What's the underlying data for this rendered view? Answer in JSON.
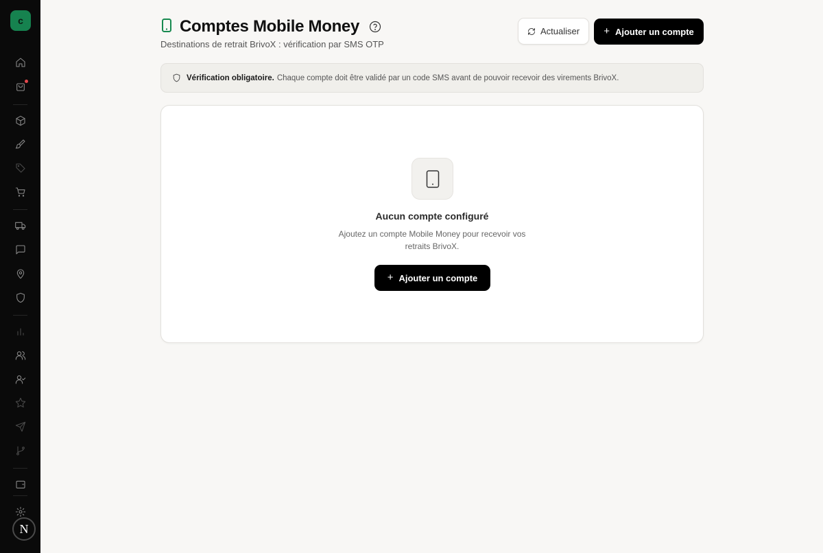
{
  "sidebar": {
    "logo_letter": "c",
    "avatar_letter": "N",
    "icons": [
      "home-icon",
      "shopping-bag-icon",
      "package-icon",
      "brush-icon",
      "tag-icon",
      "cart-icon",
      "truck-icon",
      "message-icon",
      "map-pin-icon",
      "shield-icon",
      "bar-chart-icon",
      "users-icon",
      "user-check-icon",
      "star-icon",
      "send-icon",
      "git-branch-icon",
      "wallet-icon",
      "settings-icon"
    ],
    "notification_color": "#e5484d"
  },
  "header": {
    "title": "Comptes Mobile Money",
    "subtitle": "Destinations de retrait BrivoX : vérification par SMS OTP",
    "refresh_label": "Actualiser",
    "add_label": "Ajouter un compte",
    "accent_color": "#17894f"
  },
  "banner": {
    "strong": "Vérification obligatoire.",
    "text": "Chaque compte doit être validé par un code SMS avant de pouvoir recevoir des virements BrivoX."
  },
  "empty_state": {
    "title": "Aucun compte configuré",
    "description": "Ajoutez un compte Mobile Money pour recevoir vos retraits BrivoX.",
    "button_label": "Ajouter un compte"
  }
}
